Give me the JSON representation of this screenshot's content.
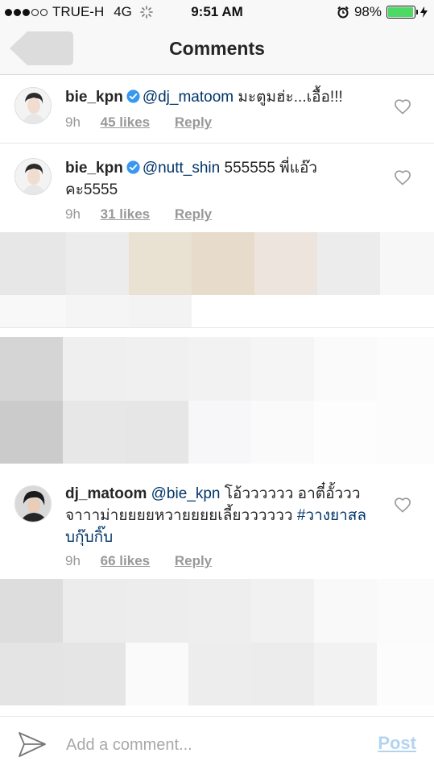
{
  "status_bar": {
    "carrier": "TRUE-H",
    "network": "4G",
    "time": "9:51 AM",
    "battery_percent": "98%",
    "battery_level": 0.98,
    "signal_filled": 3,
    "signal_total": 5
  },
  "nav": {
    "title": "Comments"
  },
  "comments": [
    {
      "username": "bie_kpn",
      "verified": true,
      "mention": "@dj_matoom",
      "text": " มะตูมฮ่ะ...เอื้อ!!!",
      "time": "9h",
      "likes": "45 likes",
      "reply": "Reply"
    },
    {
      "username": "bie_kpn",
      "verified": true,
      "mention": "@nutt_shin",
      "text": " 555555 พี่แอ๊วคะ5555",
      "time": "9h",
      "likes": "31 likes",
      "reply": "Reply"
    },
    {
      "username": "dj_matoom",
      "verified": false,
      "mention": "@bie_kpn",
      "text": " โอ้วววววว อาตี๋อั้วววจาาาม่ายยยยหวายยยยเลี้ยวววววว ",
      "hashtag": "#วางยาสลบกุ๊บกิ๊บ",
      "time": "9h",
      "likes": "66 likes",
      "reply": "Reply"
    }
  ],
  "input": {
    "placeholder": "Add a comment...",
    "value": "",
    "post_label": "Post"
  },
  "colors": {
    "link": "#003569",
    "verified": "#3897f0",
    "post_disabled": "#b3d4f0",
    "battery": "#4cd964"
  },
  "icons": {
    "back": "back-arrow-icon",
    "verified": "verified-badge-icon",
    "like": "heart-icon",
    "send": "send-icon"
  }
}
